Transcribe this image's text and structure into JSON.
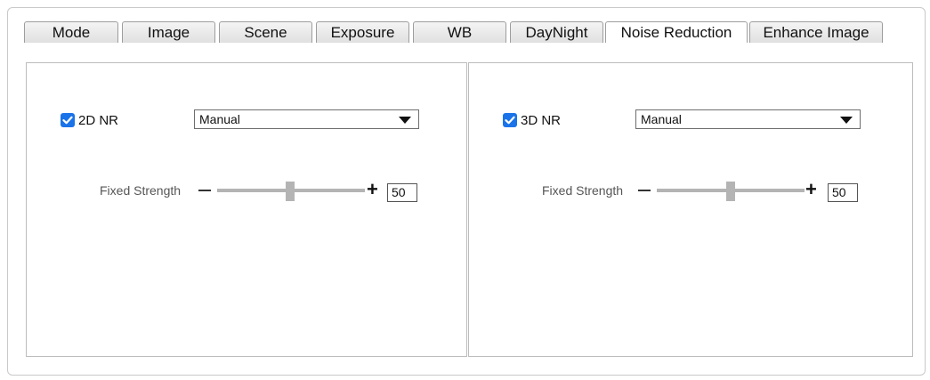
{
  "tabs": [
    {
      "label": "Mode",
      "active": false
    },
    {
      "label": "Image",
      "active": false
    },
    {
      "label": "Scene",
      "active": false
    },
    {
      "label": "Exposure",
      "active": false
    },
    {
      "label": "WB",
      "active": false
    },
    {
      "label": "DayNight",
      "active": false
    },
    {
      "label": "Noise Reduction",
      "active": true
    },
    {
      "label": "Enhance Image",
      "active": false
    }
  ],
  "nr2d": {
    "checkbox_label": "2D NR",
    "checked": true,
    "mode_value": "Manual",
    "strength_label": "Fixed Strength",
    "strength_value": "50",
    "strength_min_icon": "minus-icon",
    "strength_max_icon": "plus-icon",
    "slider_level_percent": 50
  },
  "nr3d": {
    "checkbox_label": "3D NR",
    "checked": true,
    "mode_value": "Manual",
    "strength_label": "Fixed Strength",
    "strength_value": "50",
    "strength_min_icon": "minus-icon",
    "strength_max_icon": "plus-icon",
    "slider_level_percent": 50
  },
  "colors": {
    "checkbox": "#1a73e8",
    "slider": "#b4b4b4"
  }
}
